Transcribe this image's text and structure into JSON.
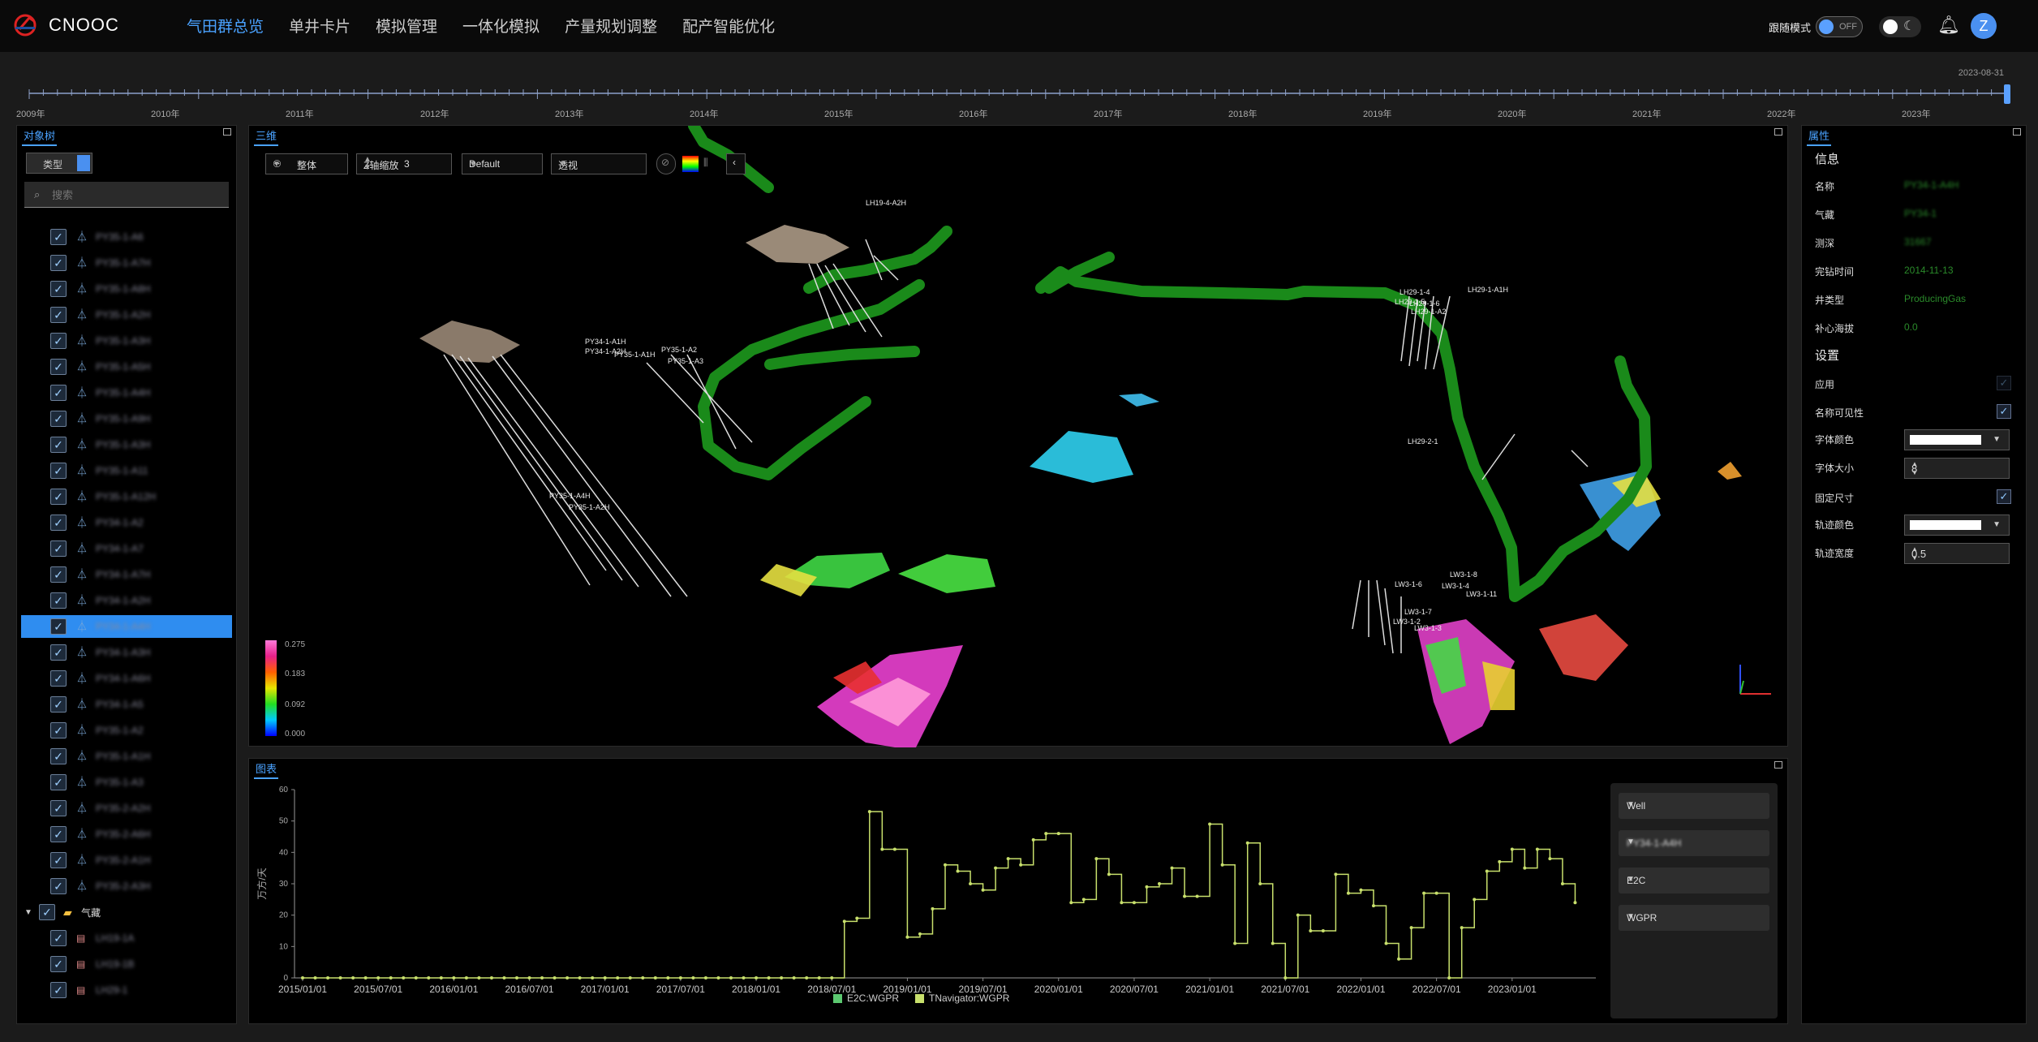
{
  "app": {
    "logo": "CNOOC"
  },
  "nav": [
    "气田群总览",
    "单井卡片",
    "模拟管理",
    "一体化模拟",
    "产量规划调整",
    "配产智能优化"
  ],
  "header": {
    "follow_mode": "跟随模式",
    "toggle_state": "OFF",
    "avatar": "Z"
  },
  "timeline": {
    "end_date": "2023-08-31",
    "years": [
      "2009年",
      "2010年",
      "2011年",
      "2012年",
      "2013年",
      "2014年",
      "2015年",
      "2016年",
      "2017年",
      "2018年",
      "2019年",
      "2020年",
      "2021年",
      "2022年",
      "2023年"
    ]
  },
  "tree": {
    "title": "对象树",
    "type_label": "类型",
    "search_placeholder": "搜索",
    "wells": [
      "PY35-1-A6",
      "PY35-1-A7H",
      "PY35-1-A8H",
      "PY35-1-A2H",
      "PY35-1-A3H",
      "PY35-1-A5H",
      "PY35-1-A4H",
      "PY35-1-A9H",
      "PY35-1-A3H",
      "PY35-1-A11",
      "PY35-1-A12H",
      "PY34-1-A2",
      "PY34-1-A7",
      "PY34-1-A7H",
      "PY34-1-A2H",
      "PY34-1-A4H",
      "PY34-1-A3H",
      "PY34-1-A6H",
      "PY34-1-A5",
      "PY35-1-A2",
      "PY35-1-A1H",
      "PY35-1-A3",
      "PY35-2-A2H",
      "PY35-2-A6H",
      "PY35-2-A1H",
      "PY35-2-A3H"
    ],
    "selected_index": 15,
    "group": "气藏",
    "reservoirs": [
      "LH19-1A",
      "LH19-1B",
      "LH29-1"
    ]
  },
  "view3d": {
    "title": "三维",
    "whole": "整体",
    "zscale_label": "Z轴缩放",
    "zscale_value": "3",
    "color_mode": "Default",
    "projection": "透视",
    "colorbar": [
      "0.275",
      "0.183",
      "0.092",
      "0.000"
    ],
    "labels": [
      "LH19-4-A2H",
      "PY35-1-A1H",
      "PY35-1-A2",
      "PY35-1-A3",
      "PY34-1-A1H",
      "PY34-1-A2H",
      "PY35-1-A4H",
      "PY35-1-A2H",
      "LH29-1-4",
      "LH29-1-5",
      "LH29-1-6",
      "LH29-1-A2",
      "LH29-1-A1H",
      "LH29-2-1",
      "LW3-1-8",
      "LW3-1-6",
      "LW3-1-4",
      "LW3-1-11",
      "LW3-1-7",
      "LW3-1-2",
      "LW3-1-3"
    ]
  },
  "chart_panel": {
    "title": "图表",
    "selectors": [
      "Well",
      "PY34-1-A4H",
      "E2C",
      "WGPR"
    ]
  },
  "chart_data": {
    "type": "line",
    "ylabel": "万方/天",
    "ylim": [
      0,
      60
    ],
    "yticks": [
      "0",
      "10",
      "20",
      "30",
      "40",
      "50",
      "60"
    ],
    "xticks": [
      "2015/01/01",
      "2015/07/01",
      "2016/01/01",
      "2016/07/01",
      "2017/01/01",
      "2017/07/01",
      "2018/01/01",
      "2018/07/01",
      "2019/01/01",
      "2019/07/01",
      "2020/01/01",
      "2020/07/01",
      "2021/01/01",
      "2021/07/01",
      "2022/01/01",
      "2022/07/01",
      "2023/01/01"
    ],
    "x_start": "2015/01/01",
    "x_end": "2023/08/01",
    "series": [
      {
        "name": "E2C:WGPR",
        "color": "#5cc870",
        "values": []
      },
      {
        "name": "TNavigator:WGPR",
        "color": "#c8e06c",
        "values": [
          0,
          0,
          0,
          0,
          0,
          0,
          0,
          0,
          0,
          0,
          0,
          0,
          0,
          0,
          0,
          0,
          0,
          0,
          0,
          0,
          0,
          0,
          0,
          0,
          0,
          0,
          0,
          0,
          0,
          0,
          0,
          0,
          0,
          0,
          0,
          0,
          0,
          0,
          0,
          0,
          0,
          0,
          0,
          18,
          19,
          53,
          41,
          41,
          13,
          14,
          22,
          36,
          34,
          30,
          28,
          35,
          38,
          36,
          44,
          46,
          46,
          24,
          25,
          38,
          33,
          24,
          24,
          29,
          30,
          35,
          26,
          26,
          49,
          36,
          11,
          43,
          30,
          11,
          0,
          20,
          15,
          15,
          33,
          27,
          28,
          23,
          11,
          6,
          16,
          27,
          27,
          0,
          16,
          25,
          34,
          37,
          41,
          35,
          41,
          38,
          30,
          24
        ]
      }
    ],
    "x_step_months": 1
  },
  "properties": {
    "title": "属性",
    "info_section": "信息",
    "info": [
      {
        "key": "名称",
        "value": "PY34-1-A4H",
        "blur": true
      },
      {
        "key": "气藏",
        "value": "PY34-1",
        "blur": true
      },
      {
        "key": "测深",
        "value": "31667",
        "blur": true
      },
      {
        "key": "完钻时间",
        "value": "2014-11-13",
        "blur": false
      },
      {
        "key": "井类型",
        "value": "ProducingGas",
        "blur": false
      },
      {
        "key": "补心海拔",
        "value": "0.0",
        "blur": false
      }
    ],
    "settings_section": "设置",
    "settings": {
      "apply": "应用",
      "name_visible": "名称可见性",
      "font_color": "字体颜色",
      "font_size": "字体大小",
      "font_size_value": "8",
      "fixed_size": "固定尺寸",
      "track_color": "轨迹颜色",
      "track_width": "轨迹宽度",
      "track_width_value": "0.5"
    }
  }
}
